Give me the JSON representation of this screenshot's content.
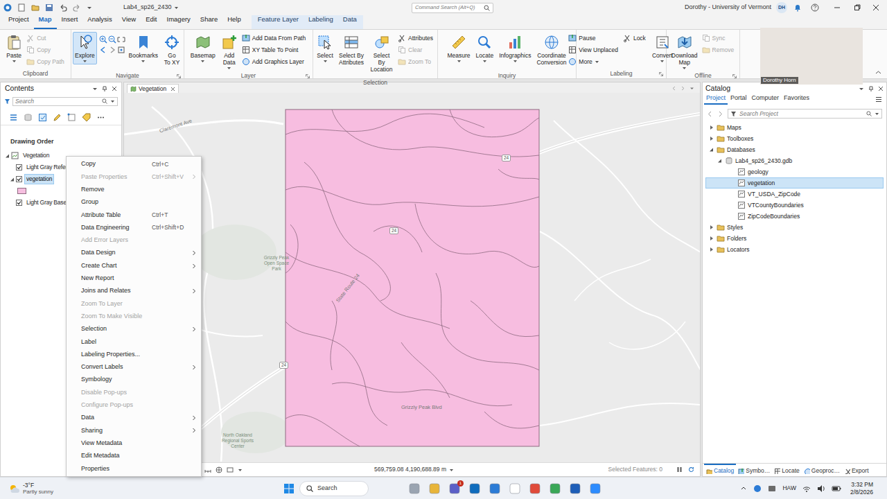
{
  "window": {
    "title": "Lab4_sp26_2430",
    "command_search": "Command Search (Alt+Q)",
    "user": "Dorothy - University of Vermont",
    "initials": "DH"
  },
  "ribbon_tabs": [
    {
      "label": "Project",
      "selected": false,
      "contextual": false
    },
    {
      "label": "Map",
      "selected": true,
      "contextual": false
    },
    {
      "label": "Insert",
      "selected": false,
      "contextual": false
    },
    {
      "label": "Analysis",
      "selected": false,
      "contextual": false
    },
    {
      "label": "View",
      "selected": false,
      "contextual": false
    },
    {
      "label": "Edit",
      "selected": false,
      "contextual": false
    },
    {
      "label": "Imagery",
      "selected": false,
      "contextual": false
    },
    {
      "label": "Share",
      "selected": false,
      "contextual": false
    },
    {
      "label": "Help",
      "selected": false,
      "contextual": false
    },
    {
      "label": "Feature Layer",
      "selected": false,
      "contextual": true
    },
    {
      "label": "Labeling",
      "selected": false,
      "contextual": true
    },
    {
      "label": "Data",
      "selected": false,
      "contextual": true
    }
  ],
  "ribbon_groups": [
    {
      "label": "Clipboard",
      "columns": [
        {
          "kind": "large",
          "label": "Paste",
          "dropdown": true,
          "disabled": false,
          "selected": false
        },
        {
          "kind": "small",
          "items": [
            {
              "label": "Cut",
              "disabled": true,
              "dropdown": false
            },
            {
              "label": "Copy",
              "disabled": true,
              "dropdown": false
            },
            {
              "label": "Copy Path",
              "disabled": true,
              "dropdown": false
            }
          ]
        }
      ]
    },
    {
      "label": "Navigate",
      "columns": [
        {
          "kind": "large",
          "label": "Explore",
          "dropdown": true,
          "disabled": false,
          "selected": true
        },
        {
          "kind": "icons"
        },
        {
          "kind": "large",
          "label": "Bookmarks",
          "dropdown": true,
          "disabled": false,
          "selected": false
        },
        {
          "kind": "large",
          "label": "Go\nTo XY",
          "dropdown": false,
          "disabled": false,
          "selected": false
        }
      ]
    },
    {
      "label": "Layer",
      "columns": [
        {
          "kind": "large",
          "label": "Basemap",
          "dropdown": true,
          "disabled": false,
          "selected": false
        },
        {
          "kind": "large",
          "label": "Add\nData",
          "dropdown": true,
          "disabled": false,
          "selected": false
        },
        {
          "kind": "small",
          "items": [
            {
              "label": "Add Data From Path",
              "disabled": false,
              "dropdown": false
            },
            {
              "label": "XY Table To Point",
              "disabled": false,
              "dropdown": false
            },
            {
              "label": "Add Graphics Layer",
              "disabled": false,
              "dropdown": false
            }
          ]
        }
      ]
    },
    {
      "label": "Selection",
      "columns": [
        {
          "kind": "large",
          "label": "Select",
          "dropdown": true,
          "disabled": false,
          "selected": false
        },
        {
          "kind": "large",
          "label": "Select By\nAttributes",
          "dropdown": false,
          "disabled": false,
          "selected": false
        },
        {
          "kind": "large",
          "label": "Select By\nLocation",
          "dropdown": false,
          "disabled": false,
          "selected": false
        },
        {
          "kind": "small",
          "items": [
            {
              "label": "Attributes",
              "disabled": false,
              "dropdown": false
            },
            {
              "label": "Clear",
              "disabled": true,
              "dropdown": false
            },
            {
              "label": "Zoom To",
              "disabled": true,
              "dropdown": false
            }
          ]
        }
      ]
    },
    {
      "label": "Inquiry",
      "columns": [
        {
          "kind": "large",
          "label": "Measure",
          "dropdown": true,
          "disabled": false,
          "selected": false
        },
        {
          "kind": "large",
          "label": "Locate",
          "dropdown": true,
          "disabled": false,
          "selected": false
        },
        {
          "kind": "large",
          "label": "Infographics",
          "dropdown": true,
          "disabled": false,
          "selected": false
        },
        {
          "kind": "large",
          "label": "Coordinate\nConversion",
          "dropdown": false,
          "disabled": false,
          "selected": false
        }
      ]
    },
    {
      "label": "Labeling",
      "columns": [
        {
          "kind": "small",
          "items": [
            {
              "label": "Pause",
              "disabled": false,
              "dropdown": false
            },
            {
              "label": "View Unplaced",
              "disabled": false,
              "dropdown": false
            },
            {
              "label": "More",
              "disabled": false,
              "dropdown": true
            }
          ]
        },
        {
          "kind": "small",
          "items": [
            {
              "label": "Lock",
              "disabled": false,
              "dropdown": false
            }
          ]
        },
        {
          "kind": "large",
          "label": "Convert",
          "dropdown": true,
          "disabled": false,
          "selected": false
        }
      ]
    },
    {
      "label": "Offline",
      "columns": [
        {
          "kind": "large",
          "label": "Download\nMap",
          "dropdown": true,
          "disabled": false,
          "selected": false
        },
        {
          "kind": "small",
          "items": [
            {
              "label": "Sync",
              "disabled": true,
              "dropdown": false
            },
            {
              "label": "Remove",
              "disabled": true,
              "dropdown": false
            }
          ]
        }
      ]
    }
  ],
  "video_overlay": {
    "name": "Dorothy Horn"
  },
  "contents": {
    "title": "Contents",
    "search_placeholder": "Search",
    "section": "Drawing Order",
    "items": [
      {
        "label": "Vegetation",
        "kind": "map",
        "expanded": true,
        "selected": false
      },
      {
        "label": "Light Gray Refere",
        "kind": "layer",
        "checked": true,
        "expanded": false,
        "selected": false
      },
      {
        "label": "vegetation",
        "kind": "layer",
        "checked": true,
        "expanded": true,
        "selected": true
      },
      {
        "kind": "symbol",
        "color": "#f6bfe0",
        "selected": false
      },
      {
        "label": "Light Gray Base",
        "kind": "layer",
        "checked": true,
        "expanded": false,
        "selected": false
      }
    ]
  },
  "context_menu": [
    {
      "label": "Copy",
      "shortcut": "Ctrl+C",
      "disabled": false,
      "submenu": false
    },
    {
      "label": "Paste Properties",
      "shortcut": "Ctrl+Shift+V",
      "disabled": true,
      "submenu": true
    },
    {
      "label": "Remove",
      "disabled": false,
      "submenu": false
    },
    {
      "label": "Group",
      "disabled": false,
      "submenu": false
    },
    {
      "label": "Attribute Table",
      "shortcut": "Ctrl+T",
      "disabled": false,
      "submenu": false
    },
    {
      "label": "Data Engineering",
      "shortcut": "Ctrl+Shift+D",
      "disabled": false,
      "submenu": false
    },
    {
      "label": "Add Error Layers",
      "disabled": true,
      "submenu": false
    },
    {
      "label": "Data Design",
      "disabled": false,
      "submenu": true
    },
    {
      "label": "Create Chart",
      "disabled": false,
      "submenu": true
    },
    {
      "label": "New Report",
      "disabled": false,
      "submenu": false
    },
    {
      "label": "Joins and Relates",
      "disabled": false,
      "submenu": true
    },
    {
      "label": "Zoom To Layer",
      "disabled": true,
      "submenu": false
    },
    {
      "label": "Zoom To Make Visible",
      "disabled": true,
      "submenu": false
    },
    {
      "label": "Selection",
      "disabled": false,
      "submenu": true
    },
    {
      "label": "Label",
      "disabled": false,
      "submenu": false
    },
    {
      "label": "Labeling Properties...",
      "disabled": false,
      "submenu": false
    },
    {
      "label": "Convert Labels",
      "disabled": false,
      "submenu": true
    },
    {
      "label": "Symbology",
      "disabled": false,
      "submenu": false
    },
    {
      "label": "Disable Pop-ups",
      "disabled": true,
      "submenu": false
    },
    {
      "label": "Configure Pop-ups",
      "disabled": true,
      "submenu": false
    },
    {
      "label": "Data",
      "disabled": false,
      "submenu": true
    },
    {
      "label": "Sharing",
      "disabled": false,
      "submenu": true
    },
    {
      "label": "View Metadata",
      "disabled": false,
      "submenu": false
    },
    {
      "label": "Edit Metadata",
      "disabled": false,
      "submenu": false
    },
    {
      "label": "Properties",
      "disabled": false,
      "submenu": false
    }
  ],
  "map": {
    "tab": "Vegetation",
    "labels": [
      {
        "text": "Claremont Ave",
        "kind": "road"
      },
      {
        "text": "24",
        "kind": "shield"
      },
      {
        "text": "24",
        "kind": "shield"
      },
      {
        "text": "24",
        "kind": "shield"
      },
      {
        "text": "State Route 24",
        "kind": "road"
      },
      {
        "text": "Grizzly Peak Open Space Park",
        "kind": "park"
      },
      {
        "text": "Grizzly Peak Blvd",
        "kind": "road"
      },
      {
        "text": "North Oakland Regional Sports Center",
        "kind": "park"
      }
    ],
    "coordinates": "569,759.08 4,190,688.89 m",
    "selected_features": "Selected Features: 0"
  },
  "catalog": {
    "title": "Catalog",
    "tabs": [
      {
        "label": "Project",
        "selected": true
      },
      {
        "label": "Portal",
        "selected": false
      },
      {
        "label": "Computer",
        "selected": false
      },
      {
        "label": "Favorites",
        "selected": false
      }
    ],
    "search_placeholder": "Search Project",
    "tree": [
      {
        "label": "Maps",
        "depth": 0,
        "kind": "folder",
        "expanded": false,
        "selected": false
      },
      {
        "label": "Toolboxes",
        "depth": 0,
        "kind": "folder",
        "expanded": false,
        "selected": false
      },
      {
        "label": "Databases",
        "depth": 0,
        "kind": "folder",
        "expanded": true,
        "selected": false
      },
      {
        "label": "Lab4_sp26_2430.gdb",
        "depth": 1,
        "kind": "gdb",
        "expanded": true,
        "selected": false
      },
      {
        "label": "geology",
        "depth": 2,
        "kind": "featureclass",
        "expanded": false,
        "selected": false
      },
      {
        "label": "vegetation",
        "depth": 2,
        "kind": "featureclass",
        "expanded": false,
        "selected": true
      },
      {
        "label": "VT_USDA_ZipCode",
        "depth": 2,
        "kind": "featureclass",
        "expanded": false,
        "selected": false
      },
      {
        "label": "VTCountyBoundaries",
        "depth": 2,
        "kind": "featureclass",
        "expanded": false,
        "selected": false
      },
      {
        "label": "ZipCodeBoundaries",
        "depth": 2,
        "kind": "featureclass",
        "expanded": false,
        "selected": false
      },
      {
        "label": "Styles",
        "depth": 0,
        "kind": "folder",
        "expanded": false,
        "selected": false
      },
      {
        "label": "Folders",
        "depth": 0,
        "kind": "folder",
        "expanded": false,
        "selected": false
      },
      {
        "label": "Locators",
        "depth": 0,
        "kind": "folder",
        "expanded": false,
        "selected": false
      }
    ],
    "bottom_tabs": [
      {
        "label": "Catalog",
        "selected": true
      },
      {
        "label": "Symbo…",
        "selected": false
      },
      {
        "label": "Locate",
        "selected": false
      },
      {
        "label": "Geoproc…",
        "selected": false
      },
      {
        "label": "Export",
        "selected": false
      }
    ]
  },
  "taskbar": {
    "weather_temp": "-3°F",
    "weather_desc": "Partly sunny",
    "search": "Search",
    "badge": "1",
    "tray_text": "HAW",
    "time": "3:32 PM",
    "date": "2/8/2026"
  }
}
